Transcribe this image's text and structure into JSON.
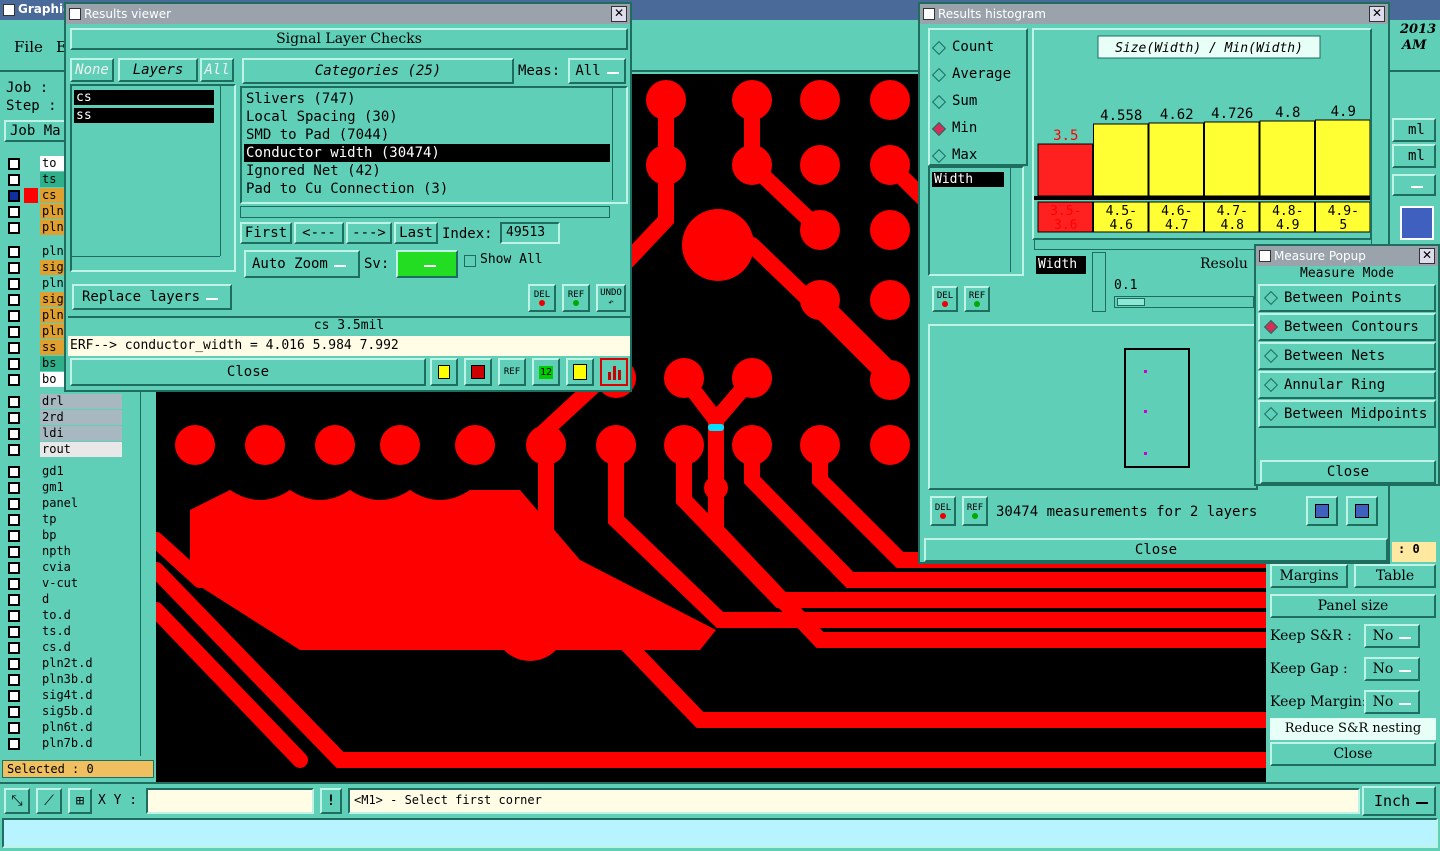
{
  "main_window": {
    "title": "Graphic",
    "menu": [
      "File",
      "E"
    ],
    "job_label": "Job :",
    "step_label": "Step :",
    "job_manager_label": "Job Ma",
    "year": "2013",
    "ampm": "AM",
    "selected": "Selected : 0",
    "xy_label": "X Y :",
    "xy_value": "",
    "status_msg": "<M1> - Select first corner",
    "units": "Inch",
    "layers": [
      {
        "name": "to",
        "color": "#ffffff"
      },
      {
        "name": "ts",
        "color": "#2fb08a"
      },
      {
        "name": "cs",
        "color": "#e0a030"
      },
      {
        "name": "pln",
        "color": "#e0a030"
      },
      {
        "name": "pln",
        "color": "#e0a030"
      },
      {
        "name": "pln",
        "color": "#5fcfb8"
      },
      {
        "name": "sig",
        "color": "#e0a030"
      },
      {
        "name": "pln",
        "color": "#5fcfb8"
      },
      {
        "name": "sig",
        "color": "#e0a030"
      },
      {
        "name": "pln",
        "color": "#e0a030"
      },
      {
        "name": "pln",
        "color": "#e0a030"
      },
      {
        "name": "ss",
        "color": "#e0a030"
      },
      {
        "name": "bs",
        "color": "#2fb08a"
      },
      {
        "name": "bo",
        "color": "#ffffff"
      },
      {
        "name": "drl",
        "color": "#a8b8c0"
      },
      {
        "name": "2rd",
        "color": "#a8b8c0"
      },
      {
        "name": "ldi",
        "color": "#a8b8c0"
      },
      {
        "name": "rout",
        "color": "#e8e8e8"
      },
      {
        "name": "gd1",
        "color": "#5fcfb8"
      },
      {
        "name": "gm1",
        "color": "#5fcfb8"
      },
      {
        "name": "panel",
        "color": "#5fcfb8"
      },
      {
        "name": "tp",
        "color": "#5fcfb8"
      },
      {
        "name": "bp",
        "color": "#5fcfb8"
      },
      {
        "name": "npth",
        "color": "#5fcfb8"
      },
      {
        "name": "cvia",
        "color": "#5fcfb8"
      },
      {
        "name": "v-cut",
        "color": "#5fcfb8"
      },
      {
        "name": "d",
        "color": "#5fcfb8"
      },
      {
        "name": "to.d",
        "color": "#5fcfb8"
      },
      {
        "name": "ts.d",
        "color": "#5fcfb8"
      },
      {
        "name": "cs.d",
        "color": "#5fcfb8"
      },
      {
        "name": "pln2t.d",
        "color": "#5fcfb8"
      },
      {
        "name": "pln3b.d",
        "color": "#5fcfb8"
      },
      {
        "name": "sig4t.d",
        "color": "#5fcfb8"
      },
      {
        "name": "sig5b.d",
        "color": "#5fcfb8"
      },
      {
        "name": "pln6t.d",
        "color": "#5fcfb8"
      },
      {
        "name": "pln7b.d",
        "color": "#5fcfb8"
      }
    ]
  },
  "results_viewer": {
    "title": "Results viewer",
    "heading": "Signal Layer Checks",
    "none_label": "None",
    "layers_label": "Layers",
    "all_label": "All",
    "categories_label": "Categories (25)",
    "meas_label": "Meas:",
    "meas_value": "All",
    "layer_list": [
      "cs",
      "ss"
    ],
    "categories": [
      "Slivers (747)",
      "Local Spacing (30)",
      "SMD to Pad (7044)",
      "Conductor width (30474)",
      "Ignored Net (42)",
      "Pad to Cu Connection (3)"
    ],
    "first_label": "First",
    "prev_label": "<---",
    "next_label": "--->",
    "last_label": "Last",
    "index_label": "Index:",
    "index_value": "49513",
    "replace_label": "Replace layers",
    "autozoom_label": "Auto Zoom",
    "sv_label": "Sv:",
    "show_all_label": "Show All",
    "del_label": "DEL",
    "ref_label": "REF",
    "undo_label": "UNDO",
    "status_line": "cs 3.5mil",
    "erf_line": "ERF--> conductor_width = 4.016 5.984 7.992",
    "close_label": "Close"
  },
  "histogram": {
    "title": "Results histogram",
    "modes": [
      "Count",
      "Average",
      "Sum",
      "Min",
      "Max"
    ],
    "selected_mode": "Min",
    "attr_list_item": "Width",
    "del_label": "DEL",
    "ref_label": "REF",
    "width_label": "Width",
    "resolution_label": "Resolu",
    "resolution_value": "0.1",
    "measurements": "30474 measurements for 2 layers",
    "close_label": "Close"
  },
  "chart_data": {
    "type": "bar",
    "title": "Size(Width) / Min(Width)",
    "categories": [
      "3.5-3.6",
      "4.5-4.6",
      "4.6-4.7",
      "4.7-4.8",
      "4.8-4.9",
      "4.9-5"
    ],
    "values": [
      3.5,
      4.558,
      4.62,
      4.726,
      4.8,
      4.9
    ],
    "value_labels": [
      "3.5",
      "4.558",
      "4.62",
      "4.726",
      "4.8",
      "4.9"
    ],
    "colors": [
      "#ff2020",
      "#ffff33",
      "#ffff33",
      "#ffff33",
      "#ffff33",
      "#ffff33"
    ],
    "ylim": [
      0,
      5.2
    ]
  },
  "measure_popup": {
    "title": "Measure Popup",
    "heading": "Measure Mode",
    "modes": [
      "Between Points",
      "Between Contours",
      "Between Nets",
      "Annular Ring",
      "Between Midpoints"
    ],
    "selected_mode": "Between Contours",
    "close_label": "Close"
  },
  "right_panel": {
    "ml1": "ml",
    "ml2": "ml",
    "coord": ": 0",
    "margins_label": "Margins",
    "table_label": "Table",
    "panel_size_label": "Panel size",
    "keep_sr_label": "Keep S&R :",
    "keep_sr_value": "No",
    "keep_gap_label": "Keep Gap :",
    "keep_gap_value": "No",
    "keep_margin_label": "Keep Margin:",
    "keep_margin_value": "No",
    "reduce_label": "Reduce S&R nesting",
    "close_label": "Close"
  }
}
